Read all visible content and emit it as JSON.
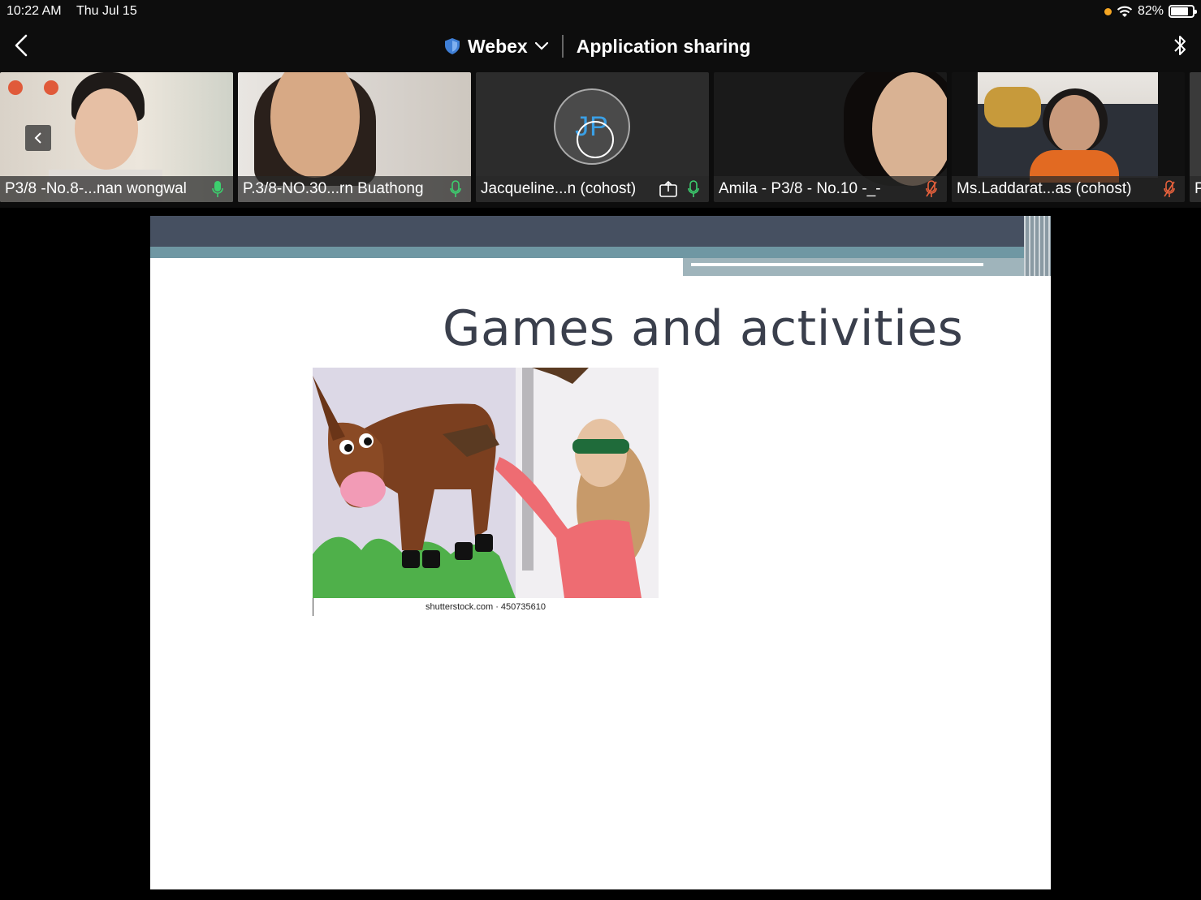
{
  "status_bar": {
    "time": "10:22 AM",
    "date": "Thu Jul 15",
    "battery": "82%",
    "battery_level": 0.82
  },
  "header": {
    "app": "Webex",
    "title": "Application sharing"
  },
  "participants": [
    {
      "name": "P3/8 -No.8-...nan wongwal",
      "mic": "on"
    },
    {
      "name": "P.3/8-NO.30...rn Buathong",
      "mic": "on"
    },
    {
      "name": "Jacqueline...n (cohost)",
      "mic": "on",
      "initials": "JP",
      "sharing": true
    },
    {
      "name": "Amila - P3/8 - No.10 -_-",
      "mic": "muted"
    },
    {
      "name": "Ms.Laddarat...as (cohost)",
      "mic": "muted"
    },
    {
      "name": "P"
    }
  ],
  "slide": {
    "title": "Games and activities",
    "image_caption": "shutterstock.com · 450735610"
  },
  "colors": {
    "mic_on": "#3ccf6e",
    "mic_muted": "#e8613c",
    "accent": "#3aa0e6"
  }
}
